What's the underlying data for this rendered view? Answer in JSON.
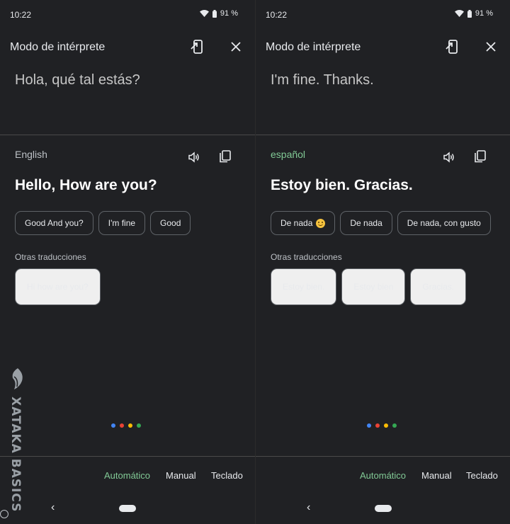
{
  "screens": [
    {
      "status": {
        "time": "10:22",
        "battery": "91 %"
      },
      "header": {
        "title": "Modo de intérprete"
      },
      "source_text": "Hola, qué tal estás?",
      "target": {
        "language": "English",
        "translation": "Hello, How are you?",
        "replies": [
          "Good And you?",
          "I'm fine",
          "Good"
        ],
        "other_label": "Otras traducciones",
        "others": [
          "Hi how are you?"
        ]
      },
      "modes": [
        "Automático",
        "Manual",
        "Teclado"
      ]
    },
    {
      "status": {
        "time": "10:22",
        "battery": "91 %"
      },
      "header": {
        "title": "Modo de intérprete"
      },
      "source_text": "I'm fine. Thanks.",
      "target": {
        "language": "español",
        "translation": "Estoy bien. Gracias.",
        "replies": [
          "De nada",
          "De nada",
          "De nada, con gusto"
        ],
        "other_label": "Otras traducciones",
        "others": [
          "Estoy bien.",
          "Estoy bien",
          "Gracias."
        ]
      },
      "modes": [
        "Automático",
        "Manual",
        "Teclado"
      ]
    }
  ],
  "watermark": {
    "text": "XATAKA BASICS"
  },
  "colors": {
    "accent_green": "#81c995",
    "background": "#202124",
    "google_dots": [
      "#4285f4",
      "#ea4335",
      "#fbbc04",
      "#34a853"
    ]
  },
  "icons": {
    "exit": "exit-interpreter-icon",
    "close": "close-icon",
    "speaker": "speaker-icon",
    "copy": "copy-icon"
  }
}
